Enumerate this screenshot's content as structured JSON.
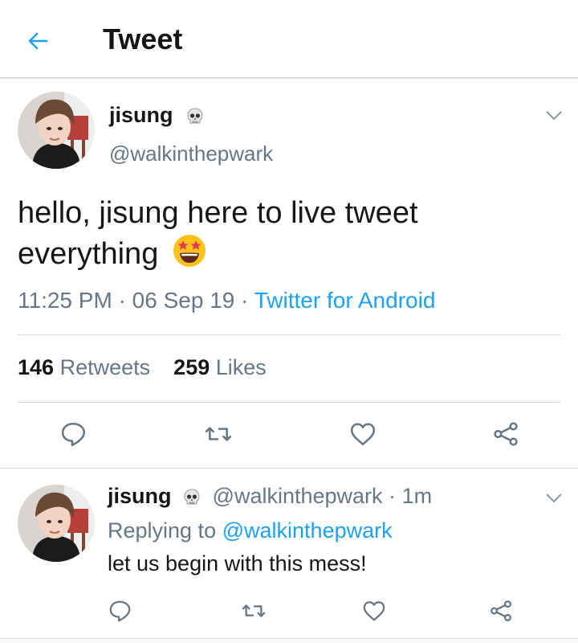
{
  "header": {
    "back_icon": "arrow-left-icon",
    "title": "Tweet",
    "accent_color": "#1da1f2"
  },
  "tweet": {
    "display_name": "jisung",
    "name_emoji": "skull-icon",
    "handle": "@walkinthepwark",
    "text": "hello, jisung here to live tweet everything",
    "text_emoji": "star-struck-emoji-icon",
    "time": "11:25 PM",
    "date": "06 Sep 19",
    "separator": "·",
    "source": "Twitter for Android",
    "retweet_count": "146",
    "retweet_label": "Retweets",
    "like_count": "259",
    "like_label": "Likes",
    "actions": [
      "reply-icon",
      "retweet-icon",
      "like-icon",
      "share-icon"
    ]
  },
  "reply": {
    "display_name": "jisung",
    "name_emoji": "skull-icon",
    "handle": "@walkinthepwark",
    "time": "1m",
    "replying_prefix": "Replying to",
    "replying_to": "@walkinthepwark",
    "text": "let us begin with this mess!",
    "actions": [
      "reply-icon",
      "retweet-icon",
      "like-icon",
      "share-icon"
    ]
  },
  "colors": {
    "text_primary": "#14171a",
    "text_secondary": "#657786",
    "link": "#1da1f2",
    "divider": "#d8dde1"
  }
}
